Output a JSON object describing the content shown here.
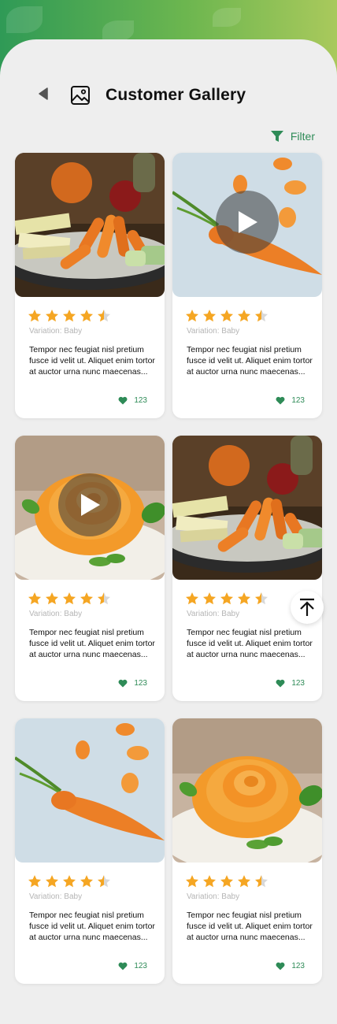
{
  "header": {
    "title": "Customer Gallery",
    "back_icon": "back-arrow-icon",
    "gallery_icon": "image-icon"
  },
  "filter": {
    "label": "Filter",
    "icon": "filter-funnel-icon",
    "color": "#2e8b57"
  },
  "colors": {
    "accent": "#2e8b57",
    "star": "#f5a623",
    "background": "#eeeeee"
  },
  "cards": [
    {
      "image": "carrots-and-apples-platter",
      "is_video": false,
      "rating": 4.5,
      "variation": "Variation: Baby",
      "description": "Tempor nec feugiat nisl pretium fusce id velit ut. Aliquet enim tortor at auctor urna nunc maecenas...",
      "likes": "123"
    },
    {
      "image": "single-carrot",
      "is_video": true,
      "rating": 4.5,
      "variation": "Variation: Baby",
      "description": "Tempor nec feugiat nisl pretium fusce id velit ut. Aliquet enim tortor at auctor urna nunc maecenas...",
      "likes": "123"
    },
    {
      "image": "carrot-rose",
      "is_video": true,
      "rating": 4.5,
      "variation": "Variation: Baby",
      "description": "Tempor nec feugiat nisl pretium fusce id velit ut. Aliquet enim tortor at auctor urna nunc maecenas...",
      "likes": "123"
    },
    {
      "image": "carrots-and-apples-platter",
      "is_video": false,
      "rating": 4.5,
      "variation": "Variation: Baby",
      "description": "Tempor nec feugiat nisl pretium fusce id velit ut. Aliquet enim tortor at auctor urna nunc maecenas...",
      "likes": "123"
    },
    {
      "image": "single-carrot",
      "is_video": false,
      "rating": 4.5,
      "variation": "Variation: Baby",
      "description": "Tempor nec feugiat nisl pretium fusce id velit ut. Aliquet enim tortor at auctor urna nunc maecenas...",
      "likes": "123"
    },
    {
      "image": "carrot-rose",
      "is_video": false,
      "rating": 4.5,
      "variation": "Variation: Baby",
      "description": "Tempor nec feugiat nisl pretium fusce id velit ut. Aliquet enim tortor at auctor urna nunc maecenas...",
      "likes": "123"
    }
  ],
  "scroll_top_icon": "arrow-up-to-top-icon"
}
